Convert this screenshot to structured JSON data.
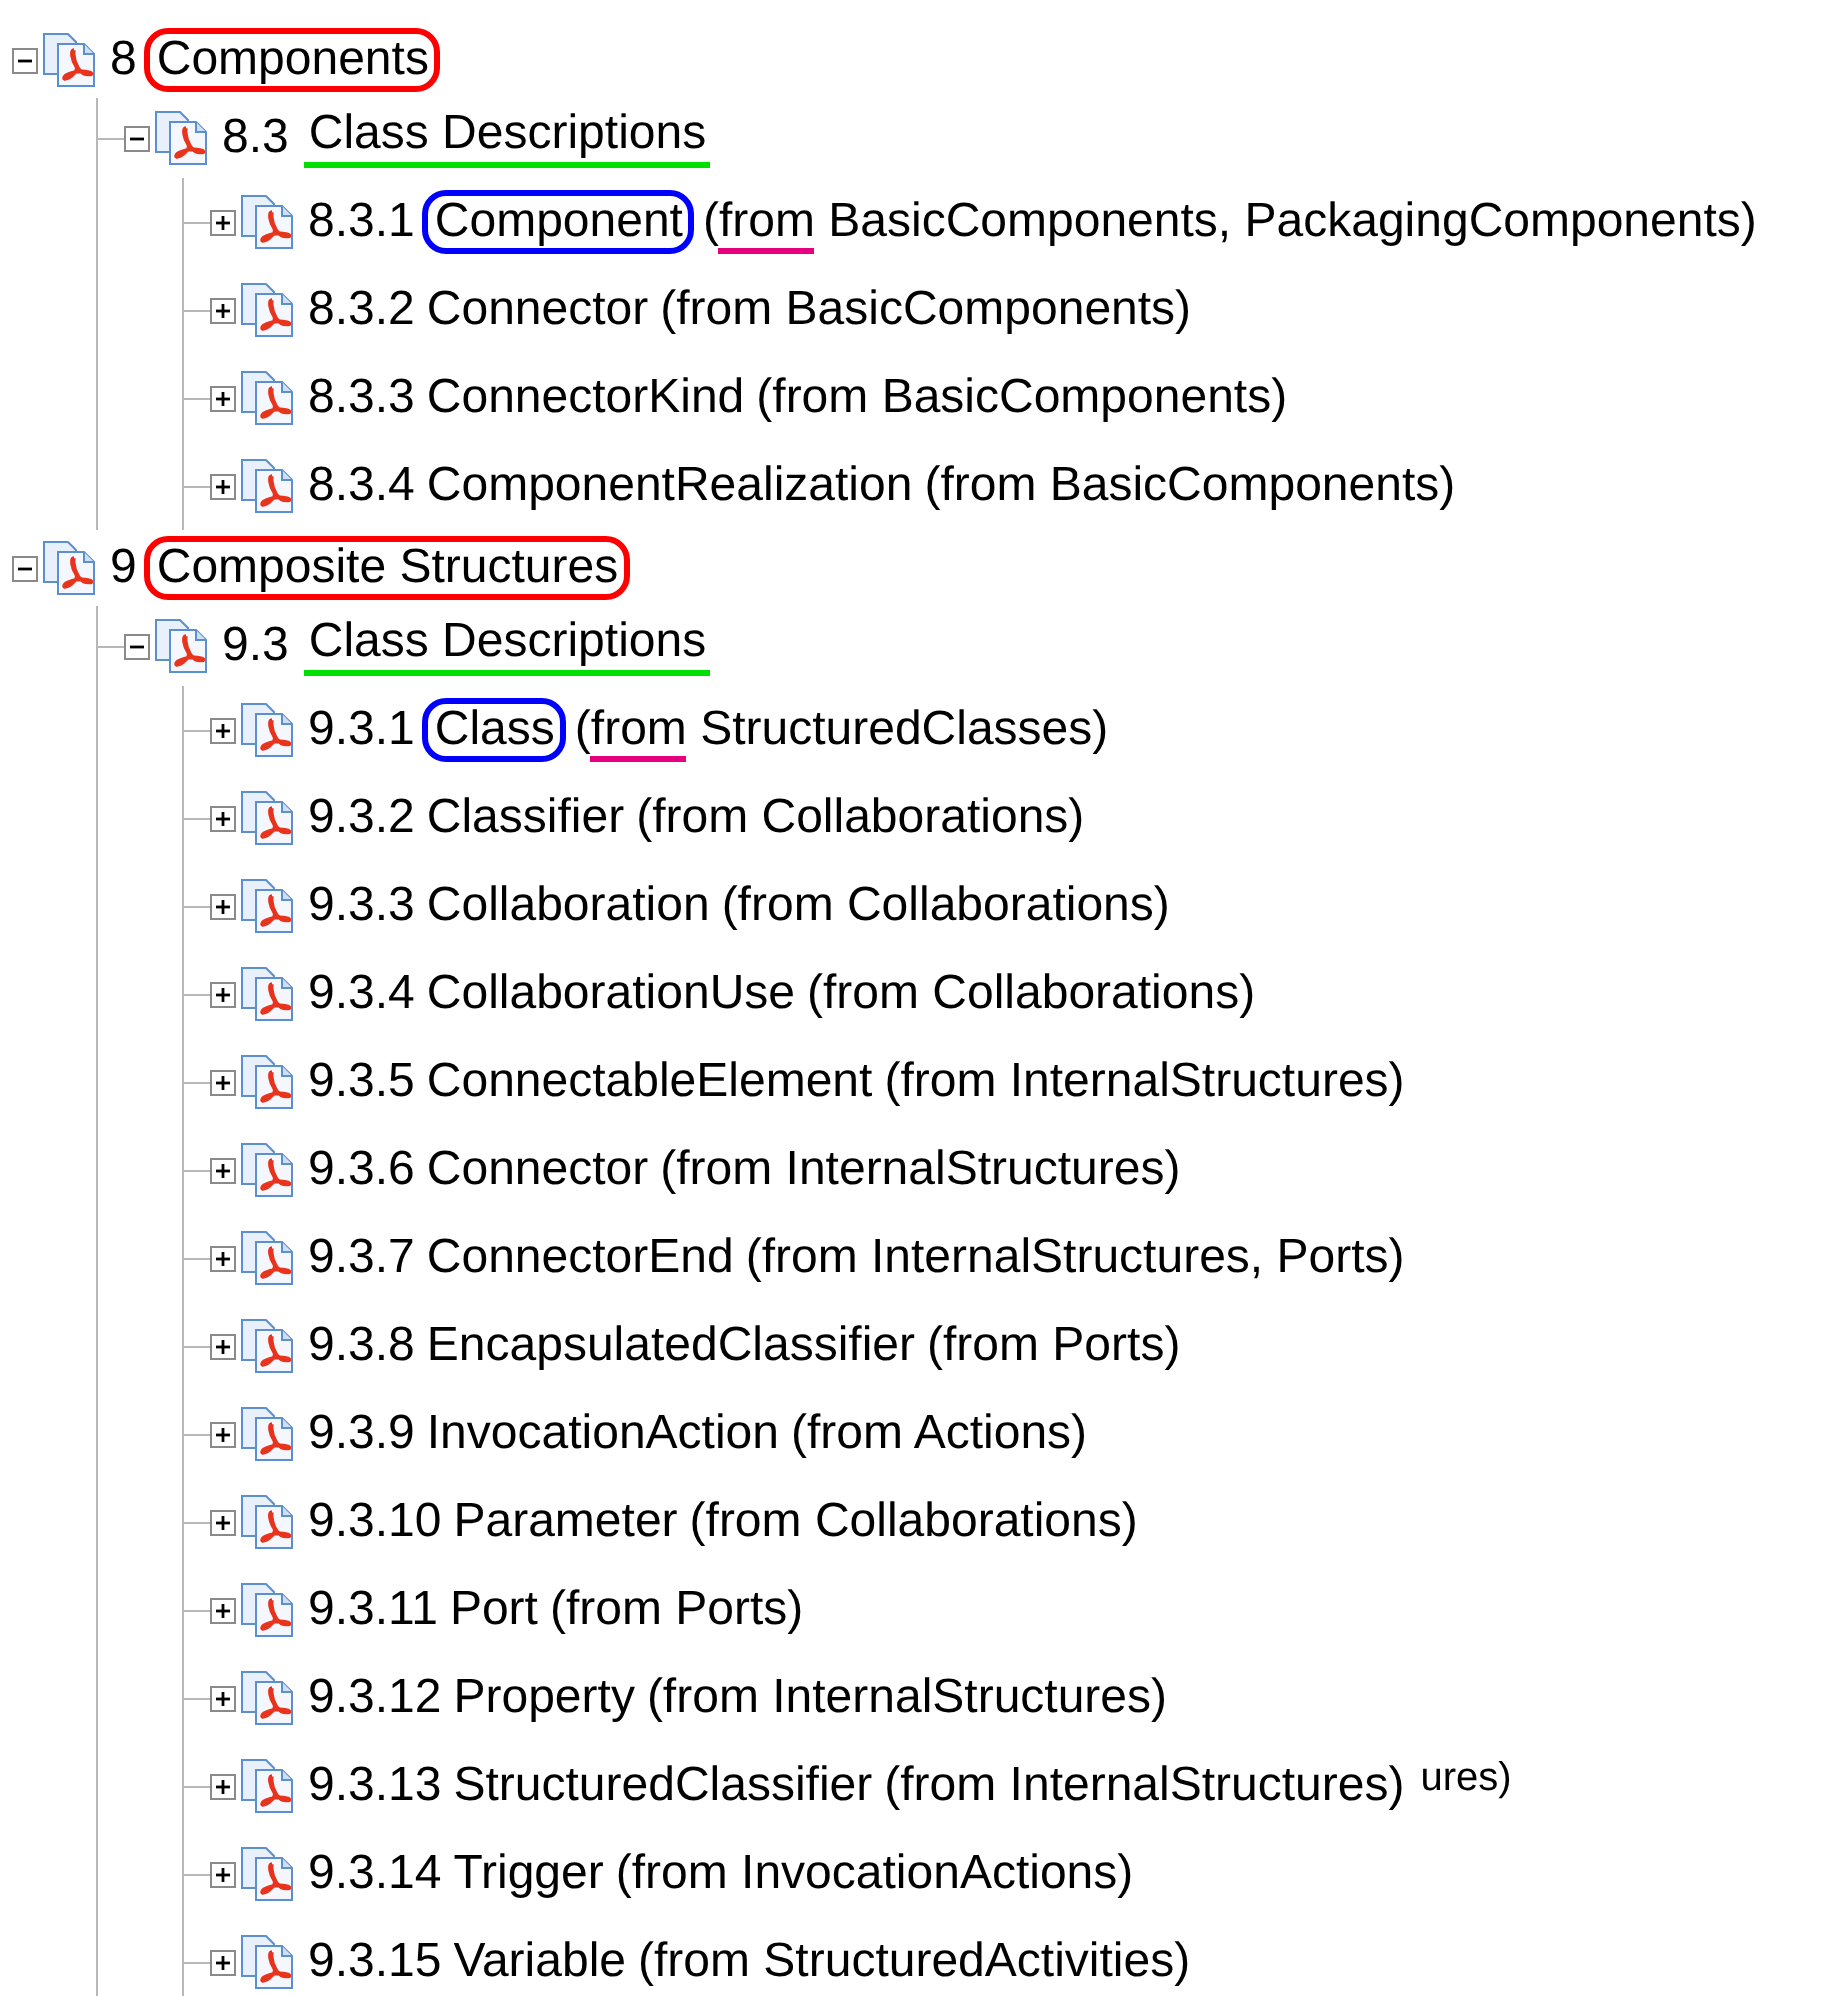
{
  "tree": [
    {
      "number": "8",
      "title": "Components",
      "expanded": true,
      "title_mark": {
        "kind": "circle",
        "color": "#ff0000"
      },
      "children": [
        {
          "number": "8.3",
          "title": "Class Descriptions",
          "expanded": true,
          "title_mark": {
            "kind": "underline",
            "color": "#00e000"
          },
          "children": [
            {
              "number": "8.3.1",
              "title": "Component",
              "expanded": false,
              "title_mark": {
                "kind": "circle",
                "color": "#0000ff"
              },
              "source": [
                "(",
                "from",
                " BasicComponents, PackagingComponents)"
              ],
              "source_mark": {
                "kind": "underline",
                "color": "#e6007e"
              }
            },
            {
              "number": "8.3.2",
              "title": "Connector",
              "expanded": false,
              "source": "(from BasicComponents)"
            },
            {
              "number": "8.3.3",
              "title": "ConnectorKind",
              "expanded": false,
              "source": "(from BasicComponents)"
            },
            {
              "number": "8.3.4",
              "title": "ComponentRealization",
              "expanded": false,
              "source": "(from BasicComponents)"
            }
          ]
        }
      ]
    },
    {
      "number": "9",
      "title": "Composite Structures",
      "expanded": true,
      "title_mark": {
        "kind": "circle",
        "color": "#ff0000"
      },
      "children": [
        {
          "number": "9.3",
          "title": "Class Descriptions",
          "expanded": true,
          "title_mark": {
            "kind": "underline",
            "color": "#00e000"
          },
          "children": [
            {
              "number": "9.3.1",
              "title": "Class",
              "expanded": false,
              "title_mark": {
                "kind": "circle",
                "color": "#0000ff"
              },
              "source": [
                "(",
                "from",
                " StructuredClasses)"
              ],
              "source_mark": {
                "kind": "underline",
                "color": "#e6007e"
              }
            },
            {
              "number": "9.3.2",
              "title": "Classifier",
              "expanded": false,
              "source": "(from Collaborations)"
            },
            {
              "number": "9.3.3",
              "title": "Collaboration",
              "expanded": false,
              "source": "(from Collaborations)"
            },
            {
              "number": "9.3.4",
              "title": "CollaborationUse",
              "expanded": false,
              "source": "(from Collaborations)"
            },
            {
              "number": "9.3.5",
              "title": "ConnectableElement",
              "expanded": false,
              "source": "(from InternalStructures)"
            },
            {
              "number": "9.3.6",
              "title": "Connector",
              "expanded": false,
              "source": "(from InternalStructures)"
            },
            {
              "number": "9.3.7",
              "title": "ConnectorEnd",
              "expanded": false,
              "source": "(from InternalStructures, Ports)"
            },
            {
              "number": "9.3.8",
              "title": "EncapsulatedClassifier",
              "expanded": false,
              "source": "(from Ports)"
            },
            {
              "number": "9.3.9",
              "title": "InvocationAction",
              "expanded": false,
              "source": "(from Actions)"
            },
            {
              "number": "9.3.10",
              "title": "Parameter",
              "expanded": false,
              "source": "(from Collaborations)"
            },
            {
              "number": "9.3.11",
              "title": "Port",
              "expanded": false,
              "source": "(from Ports)"
            },
            {
              "number": "9.3.12",
              "title": "Property",
              "expanded": false,
              "source": "(from InternalStructures)"
            },
            {
              "number": "9.3.13",
              "title": "StructuredClassifier",
              "expanded": false,
              "source": "(from InternalStructures)",
              "overflow_text": "ures)"
            },
            {
              "number": "9.3.14",
              "title": "Trigger",
              "expanded": false,
              "source": "(from InvocationActions)"
            },
            {
              "number": "9.3.15",
              "title": "Variable",
              "expanded": false,
              "source": "(from StructuredActivities)"
            }
          ]
        }
      ]
    }
  ]
}
